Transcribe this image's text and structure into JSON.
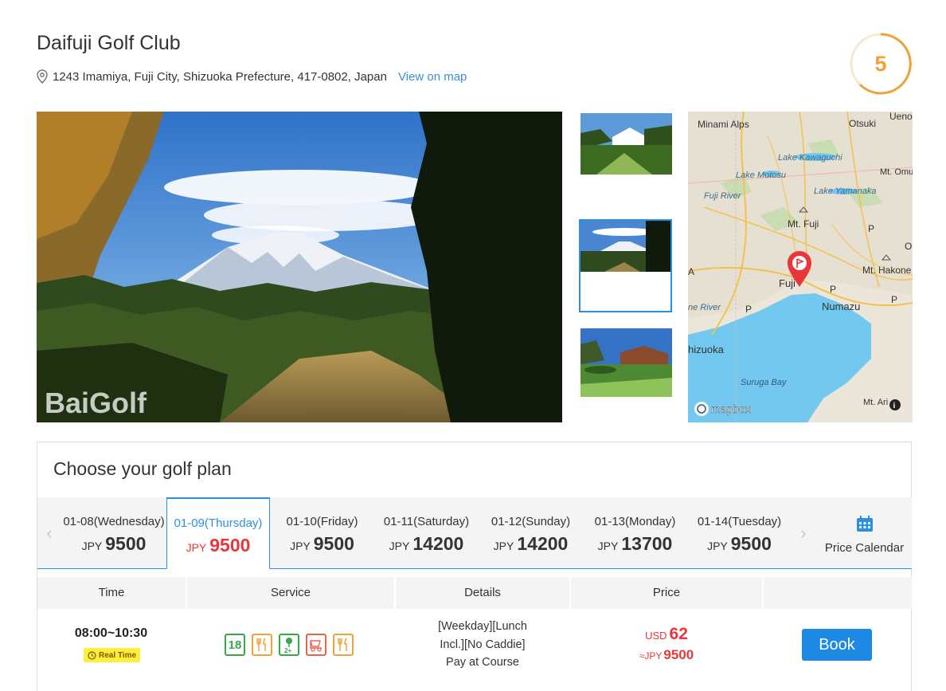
{
  "course": {
    "name": "Daifuji Golf Club",
    "address": "1243 Imamiya, Fuji City, Shizuoka Prefecture, 417-0802, Japan",
    "map_link": "View on map",
    "score": "5",
    "score_color": "#f0a23a"
  },
  "gallery": {
    "watermark": "BaiGolf",
    "icon": "photo"
  },
  "map": {
    "labels": {
      "minami_alps": "Minami Alps",
      "otsuki": "Otsuki",
      "ueno": "Ueno",
      "lake_kawaguchi": "Lake Kawaguchi",
      "mt_omu": "Mt. Omu",
      "lake_motosu": "Lake Motosu",
      "fuji_river": "Fuji River",
      "lake_yamanaka": "Lake Yamanaka",
      "mt_fuji": "Mt. Fuji",
      "p1": "P",
      "a": "A",
      "fuji": "Fuji",
      "p2": "P",
      "mt_hakone": "Mt. Hakone",
      "o": "O",
      "ne_river": "ne River",
      "p3": "P",
      "numazu": "Numazu",
      "p4": "P",
      "shizuoka": "hizuoka",
      "suruga_bay": "Suruga Bay",
      "mt_ari": "Mt. Ari",
      "mapbox": "mapbox"
    },
    "marker_color": "#e8363b",
    "sea_color": "#72c8ee"
  },
  "plan": {
    "title": "Choose your golf plan",
    "currency": "JPY",
    "dates": [
      {
        "label": "01-08(Wednesday)",
        "price": "9500"
      },
      {
        "label": "01-09(Thursday)",
        "price": "9500",
        "active": true
      },
      {
        "label": "01-10(Friday)",
        "price": "9500"
      },
      {
        "label": "01-11(Saturday)",
        "price": "14200"
      },
      {
        "label": "01-12(Sunday)",
        "price": "14200"
      },
      {
        "label": "01-13(Monday)",
        "price": "13700"
      },
      {
        "label": "01-14(Tuesday)",
        "price": "9500"
      }
    ],
    "prev_arrow": "‹",
    "next_arrow": "›",
    "calendar_label": "Price Calendar",
    "accent_color": "#2d8fe2",
    "price_color": "#e8363b"
  },
  "table": {
    "headers": {
      "time": "Time",
      "service": "Service",
      "details": "Details",
      "price": "Price"
    },
    "rows": [
      {
        "time": "08:00~10:30",
        "badge": "Real Time",
        "services": {
          "holes": "18",
          "holes_icon": "18-holes-icon",
          "lunch_icon": "cutlery-icon",
          "players": "2+",
          "players_icon": "players-icon",
          "cart_icon": "golf-cart-icon",
          "meal_icon": "cutlery-icon"
        },
        "details_line1": "[Weekday][Lunch",
        "details_line2": "Incl.][No Caddie]",
        "details_line3": "Pay at Course",
        "usd_currency": "USD",
        "usd_price": "62",
        "jpy_currency": "≈JPY",
        "jpy_price": "9500",
        "book_label": "Book"
      }
    ]
  }
}
